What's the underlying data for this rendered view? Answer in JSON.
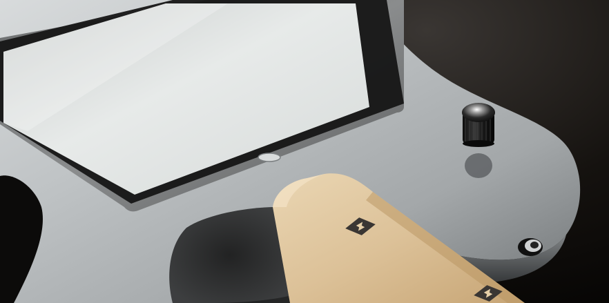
{
  "scene": {
    "subject": "guitar-body-with-tablet",
    "colors": {
      "background_dark": "#0a0807",
      "metal_light": "#c9cccd",
      "metal_mid": "#9ea2a4",
      "metal_dark": "#5f6365",
      "screen_glass": "#e3e6e5",
      "screen_bezel": "#1a1a1a",
      "wood_light": "#e6cfa8",
      "wood_dark": "#c9a777",
      "knob": "#161616"
    },
    "icons": [
      "fretboard-inlay-icon"
    ]
  }
}
